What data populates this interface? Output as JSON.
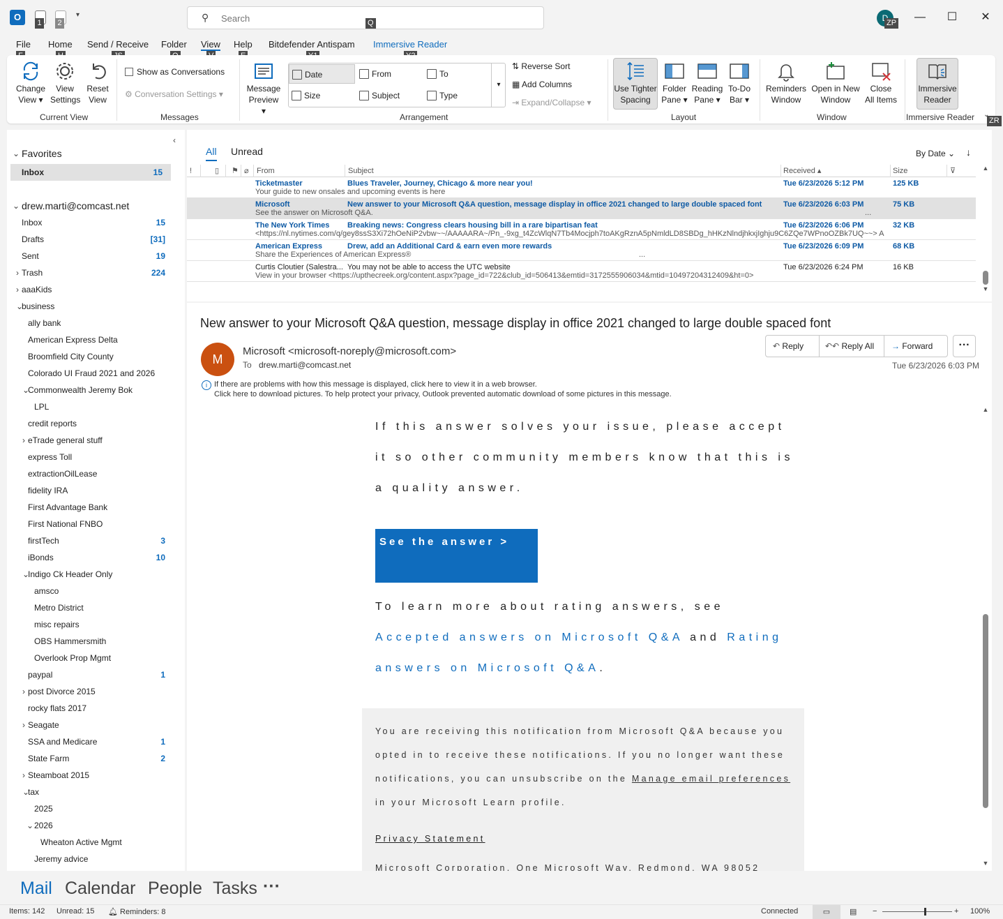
{
  "titlebar": {
    "search_placeholder": "Search",
    "avatar_initial": "D",
    "keytips": [
      "1",
      "2",
      "Q",
      "ZP"
    ]
  },
  "menu": {
    "tabs": [
      "File",
      "Home",
      "Send / Receive",
      "Folder",
      "View",
      "Help",
      "Bitdefender Antispam",
      "Immersive Reader"
    ],
    "active": "View",
    "keytips": [
      "F",
      "H",
      "JS",
      "O",
      "V",
      "E",
      "Y1",
      "Y2"
    ]
  },
  "ribbon": {
    "change_view_1": "Change",
    "change_view_2": "View",
    "view_settings_1": "View",
    "view_settings_2": "Settings",
    "reset_view_1": "Reset",
    "reset_view_2": "View",
    "show_conversations": "Show as Conversations",
    "conversation_settings": "Conversation Settings",
    "message_preview_1": "Message",
    "message_preview_2": "Preview",
    "arrange_date": "Date",
    "arrange_from": "From",
    "arrange_to": "To",
    "arrange_size": "Size",
    "arrange_subject": "Subject",
    "arrange_type": "Type",
    "reverse_sort": "Reverse Sort",
    "add_columns": "Add Columns",
    "expand_collapse": "Expand/Collapse",
    "tighter_1": "Use Tighter",
    "tighter_2": "Spacing",
    "folder_pane_1": "Folder",
    "folder_pane_2": "Pane",
    "reading_pane_1": "Reading",
    "reading_pane_2": "Pane",
    "todo_bar_1": "To-Do",
    "todo_bar_2": "Bar",
    "reminders_1": "Reminders",
    "reminders_2": "Window",
    "open_new_1": "Open in New",
    "open_new_2": "Window",
    "close_all_1": "Close",
    "close_all_2": "All Items",
    "immersive_1": "Immersive",
    "immersive_2": "Reader",
    "groups": {
      "current_view": "Current View",
      "messages": "Messages",
      "arrangement": "Arrangement",
      "layout": "Layout",
      "window": "Window",
      "immersive": "Immersive Reader"
    },
    "keytip_zr": "ZR"
  },
  "folders": {
    "favorites_header": "Favorites",
    "favorites_inbox": "Inbox",
    "favorites_inbox_count": "15",
    "account": "drew.marti@comcast.net",
    "items": [
      {
        "name": "Inbox",
        "count": "15",
        "indent": 0,
        "chev": ""
      },
      {
        "name": "Drafts",
        "count": "[31]",
        "indent": 0,
        "chev": ""
      },
      {
        "name": "Sent",
        "count": "19",
        "indent": 0,
        "chev": ""
      },
      {
        "name": "Trash",
        "count": "224",
        "indent": 0,
        "chev": ">"
      },
      {
        "name": "aaaKids",
        "count": "",
        "indent": 0,
        "chev": ">"
      },
      {
        "name": "business",
        "count": "",
        "indent": 0,
        "chev": "v"
      },
      {
        "name": "ally bank",
        "count": "",
        "indent": 1,
        "chev": ""
      },
      {
        "name": "American Express Delta",
        "count": "",
        "indent": 1,
        "chev": ""
      },
      {
        "name": "Broomfield City County",
        "count": "",
        "indent": 1,
        "chev": ""
      },
      {
        "name": "Colorado UI Fraud 2021 and 2026",
        "count": "",
        "indent": 1,
        "chev": ""
      },
      {
        "name": "Commonwealth Jeremy Bok",
        "count": "",
        "indent": 1,
        "chev": "v"
      },
      {
        "name": "LPL",
        "count": "",
        "indent": 2,
        "chev": ""
      },
      {
        "name": "credit reports",
        "count": "",
        "indent": 1,
        "chev": ""
      },
      {
        "name": "eTrade general stuff",
        "count": "",
        "indent": 1,
        "chev": ">"
      },
      {
        "name": "express Toll",
        "count": "",
        "indent": 1,
        "chev": ""
      },
      {
        "name": "extractionOilLease",
        "count": "",
        "indent": 1,
        "chev": ""
      },
      {
        "name": "fidelity IRA",
        "count": "",
        "indent": 1,
        "chev": ""
      },
      {
        "name": "First Advantage Bank",
        "count": "",
        "indent": 1,
        "chev": ""
      },
      {
        "name": "First National FNBO",
        "count": "",
        "indent": 1,
        "chev": ""
      },
      {
        "name": "firstTech",
        "count": "3",
        "indent": 1,
        "chev": ""
      },
      {
        "name": "iBonds",
        "count": "10",
        "indent": 1,
        "chev": ""
      },
      {
        "name": "Indigo Ck Header Only",
        "count": "",
        "indent": 1,
        "chev": "v"
      },
      {
        "name": "amsco",
        "count": "",
        "indent": 2,
        "chev": ""
      },
      {
        "name": "Metro District",
        "count": "",
        "indent": 2,
        "chev": ""
      },
      {
        "name": "misc repairs",
        "count": "",
        "indent": 2,
        "chev": ""
      },
      {
        "name": "OBS Hammersmith",
        "count": "",
        "indent": 2,
        "chev": ""
      },
      {
        "name": "Overlook Prop Mgmt",
        "count": "",
        "indent": 2,
        "chev": ""
      },
      {
        "name": "paypal",
        "count": "1",
        "indent": 1,
        "chev": ""
      },
      {
        "name": "post Divorce 2015",
        "count": "",
        "indent": 1,
        "chev": ">"
      },
      {
        "name": "rocky flats 2017",
        "count": "",
        "indent": 1,
        "chev": ""
      },
      {
        "name": "Seagate",
        "count": "",
        "indent": 1,
        "chev": ">"
      },
      {
        "name": "SSA and Medicare",
        "count": "1",
        "indent": 1,
        "chev": ""
      },
      {
        "name": "State Farm",
        "count": "2",
        "indent": 1,
        "chev": ""
      },
      {
        "name": "Steamboat 2015",
        "count": "",
        "indent": 1,
        "chev": ">"
      },
      {
        "name": "tax",
        "count": "",
        "indent": 1,
        "chev": "v"
      },
      {
        "name": "2025",
        "count": "",
        "indent": 2,
        "chev": ""
      },
      {
        "name": "2026",
        "count": "",
        "indent": 2,
        "chev": "v"
      },
      {
        "name": "Wheaton Active Mgmt",
        "count": "",
        "indent": 3,
        "chev": ""
      },
      {
        "name": "Jeremy advice",
        "count": "",
        "indent": 2,
        "chev": ""
      }
    ]
  },
  "message_list": {
    "tab_all": "All",
    "tab_unread": "Unread",
    "sort_label": "By Date",
    "columns": {
      "importance": "!",
      "from": "From",
      "subject": "Subject",
      "received": "Received",
      "size": "Size"
    },
    "rows": [
      {
        "from": "Ticketmaster",
        "subject": "Blues Traveler, Journey, Chicago & more near you!",
        "preview": "Your guide to new onsales and upcoming events is here",
        "received": "Tue 6/23/2026 5:12 PM",
        "size": "125 KB",
        "unread": true,
        "selected": false
      },
      {
        "from": "Microsoft",
        "subject": "New answer to your Microsoft Q&A question, message display in office 2021 changed to large double spaced font",
        "preview": "See the answer on Microsoft Q&A.",
        "received": "Tue 6/23/2026 6:03 PM",
        "size": "75 KB",
        "unread": true,
        "selected": true
      },
      {
        "from": "The New York Times",
        "subject": "Breaking news: Congress clears housing bill in a rare bipartisan feat",
        "preview": "<https://nl.nytimes.com/q/gey8ssS3Xi72hOeNiP2vbw~~/AAAAARA~/Pn_-9xg_t4ZcWlqN7Tb4Mocjph7toAKgRznA5pNmldLD8SBDg_hHKzNlndjhkxjIghju9C6ZQe7WPnoOZBk7UQ~~>  A",
        "received": "Tue 6/23/2026 6:06 PM",
        "size": "32 KB",
        "unread": true,
        "selected": false
      },
      {
        "from": "American Express",
        "subject": "Drew, add an Additional Card & earn even more rewards",
        "preview": "Share the Experiences of American Express®",
        "received": "Tue 6/23/2026 6:09 PM",
        "size": "68 KB",
        "unread": true,
        "selected": false
      },
      {
        "from": "Curtis Cloutier (Salestra...",
        "subject": "You may not be able to access the UTC website",
        "preview": "View in your browser <https://upthecreek.org/content.aspx?page_id=722&club_id=506413&emtid=3172555906034&mtid=10497204312409&ht=0>",
        "received": "Tue 6/23/2026 6:24 PM",
        "size": "16 KB",
        "unread": false,
        "selected": false
      }
    ],
    "ellipsis": "..."
  },
  "reading": {
    "subject": "New answer to your Microsoft Q&A question, message display in office 2021 changed to large double spaced font",
    "avatar_initial": "M",
    "sender": "Microsoft <microsoft-noreply@microsoft.com>",
    "to_label": "To",
    "to": "drew.marti@comcast.net",
    "date": "Tue 6/23/2026 6:03 PM",
    "reply": "Reply",
    "reply_all": "Reply All",
    "forward": "Forward",
    "more": "···",
    "info_line1": "If there are problems with how this message is displayed, click here to view it in a web browser.",
    "info_line2": "Click here to download pictures. To help protect your privacy, Outlook prevented automatic download of some pictures in this message.",
    "para1": "If this answer solves your issue, please accept it so other community members know that this is a quality answer.",
    "cta": "See the answer >",
    "para2_pre": "To learn more about rating answers, see ",
    "para2_link1": "Accepted answers on Microsoft Q&A",
    "para2_mid": " and ",
    "para2_link2": "Rating answers on Microsoft Q&A",
    "para2_end": ".",
    "footer_pre": "You are receiving this notification from Microsoft Q&A because you opted in to receive these notifications. If you no longer want these notifications, you can unsubscribe on the ",
    "footer_link": "Manage email preferences",
    "footer_post": " in your Microsoft Learn profile.",
    "privacy": "Privacy Statement",
    "address": "Microsoft Corporation, One Microsoft Way, Redmond, WA 98052"
  },
  "modules": {
    "mail": "Mail",
    "calendar": "Calendar",
    "people": "People",
    "tasks": "Tasks",
    "more": "···"
  },
  "status": {
    "items": "Items: 142",
    "unread": "Unread: 15",
    "reminders": "Reminders: 8",
    "connected": "Connected",
    "zoom": "100%",
    "zoom_fraction": 0.6
  },
  "colors": {
    "accent": "#0f6cbd",
    "avatar_sender": "#ca5010"
  }
}
